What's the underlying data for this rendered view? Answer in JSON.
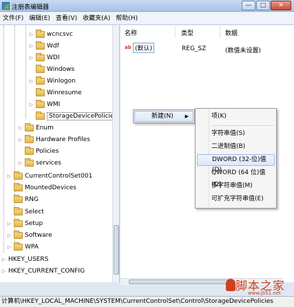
{
  "window": {
    "title": "注册表编辑器",
    "min": "—",
    "max": "□",
    "close": "✕"
  },
  "menu": [
    "文件(F)",
    "编辑(E)",
    "查看(V)",
    "收藏夹(A)",
    "帮助(H)"
  ],
  "tree": [
    "wcncsvc",
    "Wdf",
    "WDI",
    "Windows",
    "Winlogon",
    "Winresume",
    "WMI",
    "StorageDevicePolicies",
    "Enum",
    "Hardware Profiles",
    "Policies",
    "services",
    "CurrentControlSet001",
    "MountedDevices",
    "RNG",
    "Select",
    "Setup",
    "Software",
    "WPA",
    "HKEY_USERS",
    "HKEY_CURRENT_CONFIG"
  ],
  "columns": {
    "name": "名称",
    "type": "类型",
    "data": "数据"
  },
  "value_row": {
    "icon": "ab",
    "name": "(默认)",
    "type": "REG_SZ",
    "data": "(数值未设置)"
  },
  "context_menu": {
    "new": "新建(N)"
  },
  "submenu": [
    "项(K)",
    "字符串值(S)",
    "二进制值(B)",
    "DWORD (32-位)值(D)",
    "QWORD (64 位)值(Q)",
    "多字符串值(M)",
    "可扩充字符串值(E)"
  ],
  "status": "计算机\\HKEY_LOCAL_MACHINE\\SYSTEM\\CurrentControlSet\\Control\\StorageDevicePolicies",
  "watermark": {
    "main": "脚本之家",
    "sub": "www.jb51.net"
  }
}
